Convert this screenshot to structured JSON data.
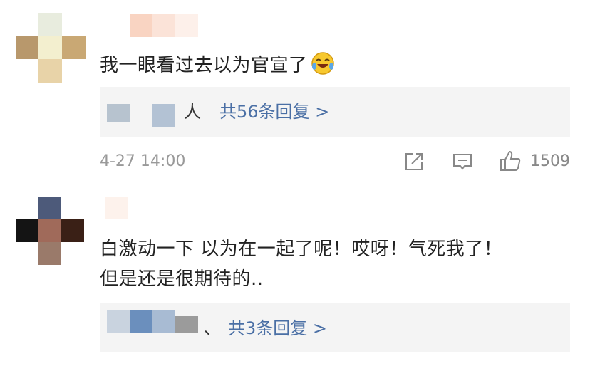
{
  "comments": [
    {
      "text": "我一眼看过去以为官宣了",
      "emoji_icon": "laughing-crying-emoji",
      "reply_preview_suffix": "人",
      "reply_link": "共56条回复 >",
      "timestamp": "4-27 14:00",
      "like_count": "1509"
    },
    {
      "text_line1": "白激动一下 以为在一起了呢！哎呀！气死我了！",
      "text_line2": "但是还是很期待的..",
      "reply_preview_suffix": "、",
      "reply_link": "共3条回复 >"
    }
  ],
  "icons": [
    "share-icon",
    "comment-icon",
    "like-icon"
  ],
  "colors": {
    "link": "#4a6fa5",
    "meta": "#999999",
    "reply_bg": "#f4f4f4"
  }
}
